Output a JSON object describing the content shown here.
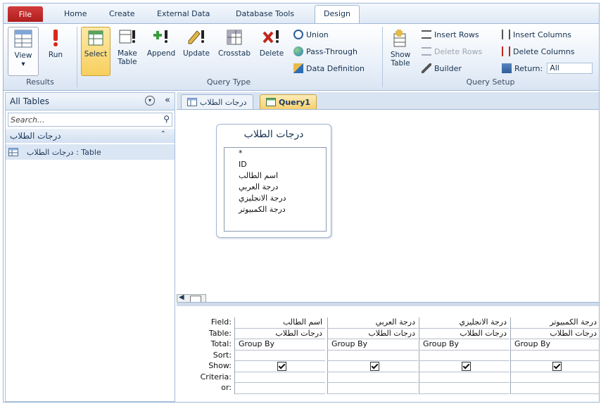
{
  "ribbon_tabs": {
    "file": "File",
    "home": "Home",
    "create": "Create",
    "external": "External Data",
    "dbtools": "Database Tools",
    "design": "Design"
  },
  "ribbon": {
    "view": "View",
    "run": "Run",
    "results_label": "Results",
    "select": "Select",
    "make_table_1": "Make",
    "make_table_2": "Table",
    "append": "Append",
    "update": "Update",
    "crosstab": "Crosstab",
    "delete": "Delete",
    "union": "Union",
    "pass_through": "Pass-Through",
    "data_definition": "Data Definition",
    "query_type_label": "Query Type",
    "show_table_1": "Show",
    "show_table_2": "Table",
    "insert_rows": "Insert Rows",
    "delete_rows": "Delete Rows",
    "builder": "Builder",
    "insert_columns": "Insert Columns",
    "delete_columns": "Delete Columns",
    "return_label": "Return:",
    "return_value": "All",
    "query_setup_label": "Query Setup"
  },
  "nav": {
    "title": "All Tables",
    "search_placeholder": "Search...",
    "category": "درجات الطلاب",
    "item": "درجات الطلاب : Table"
  },
  "doc_tabs": {
    "table_tab": "درجات الطلاب",
    "query_tab": "Query1"
  },
  "field_list": {
    "title": "درجات الطلاب",
    "fields": [
      "*",
      "ID",
      "اسم الطالب",
      "درجة العربي",
      "درجة الانجليزي",
      "درجة الكمبيوتر"
    ]
  },
  "grid": {
    "row_labels": [
      "Field:",
      "Table:",
      "Total:",
      "Sort:",
      "Show:",
      "Criteria:",
      "or:"
    ],
    "columns": [
      {
        "field": "اسم الطالب",
        "table": "درجات الطلاب",
        "total": "Group By",
        "show": true
      },
      {
        "field": "درجة العربي",
        "table": "درجات الطلاب",
        "total": "Group By",
        "show": true
      },
      {
        "field": "درجة الانجليزي",
        "table": "درجات الطلاب",
        "total": "Group By",
        "show": true
      },
      {
        "field": "درجة الكمبيوتر",
        "table": "درجات الطلاب",
        "total": "Group By",
        "show": true
      }
    ]
  }
}
